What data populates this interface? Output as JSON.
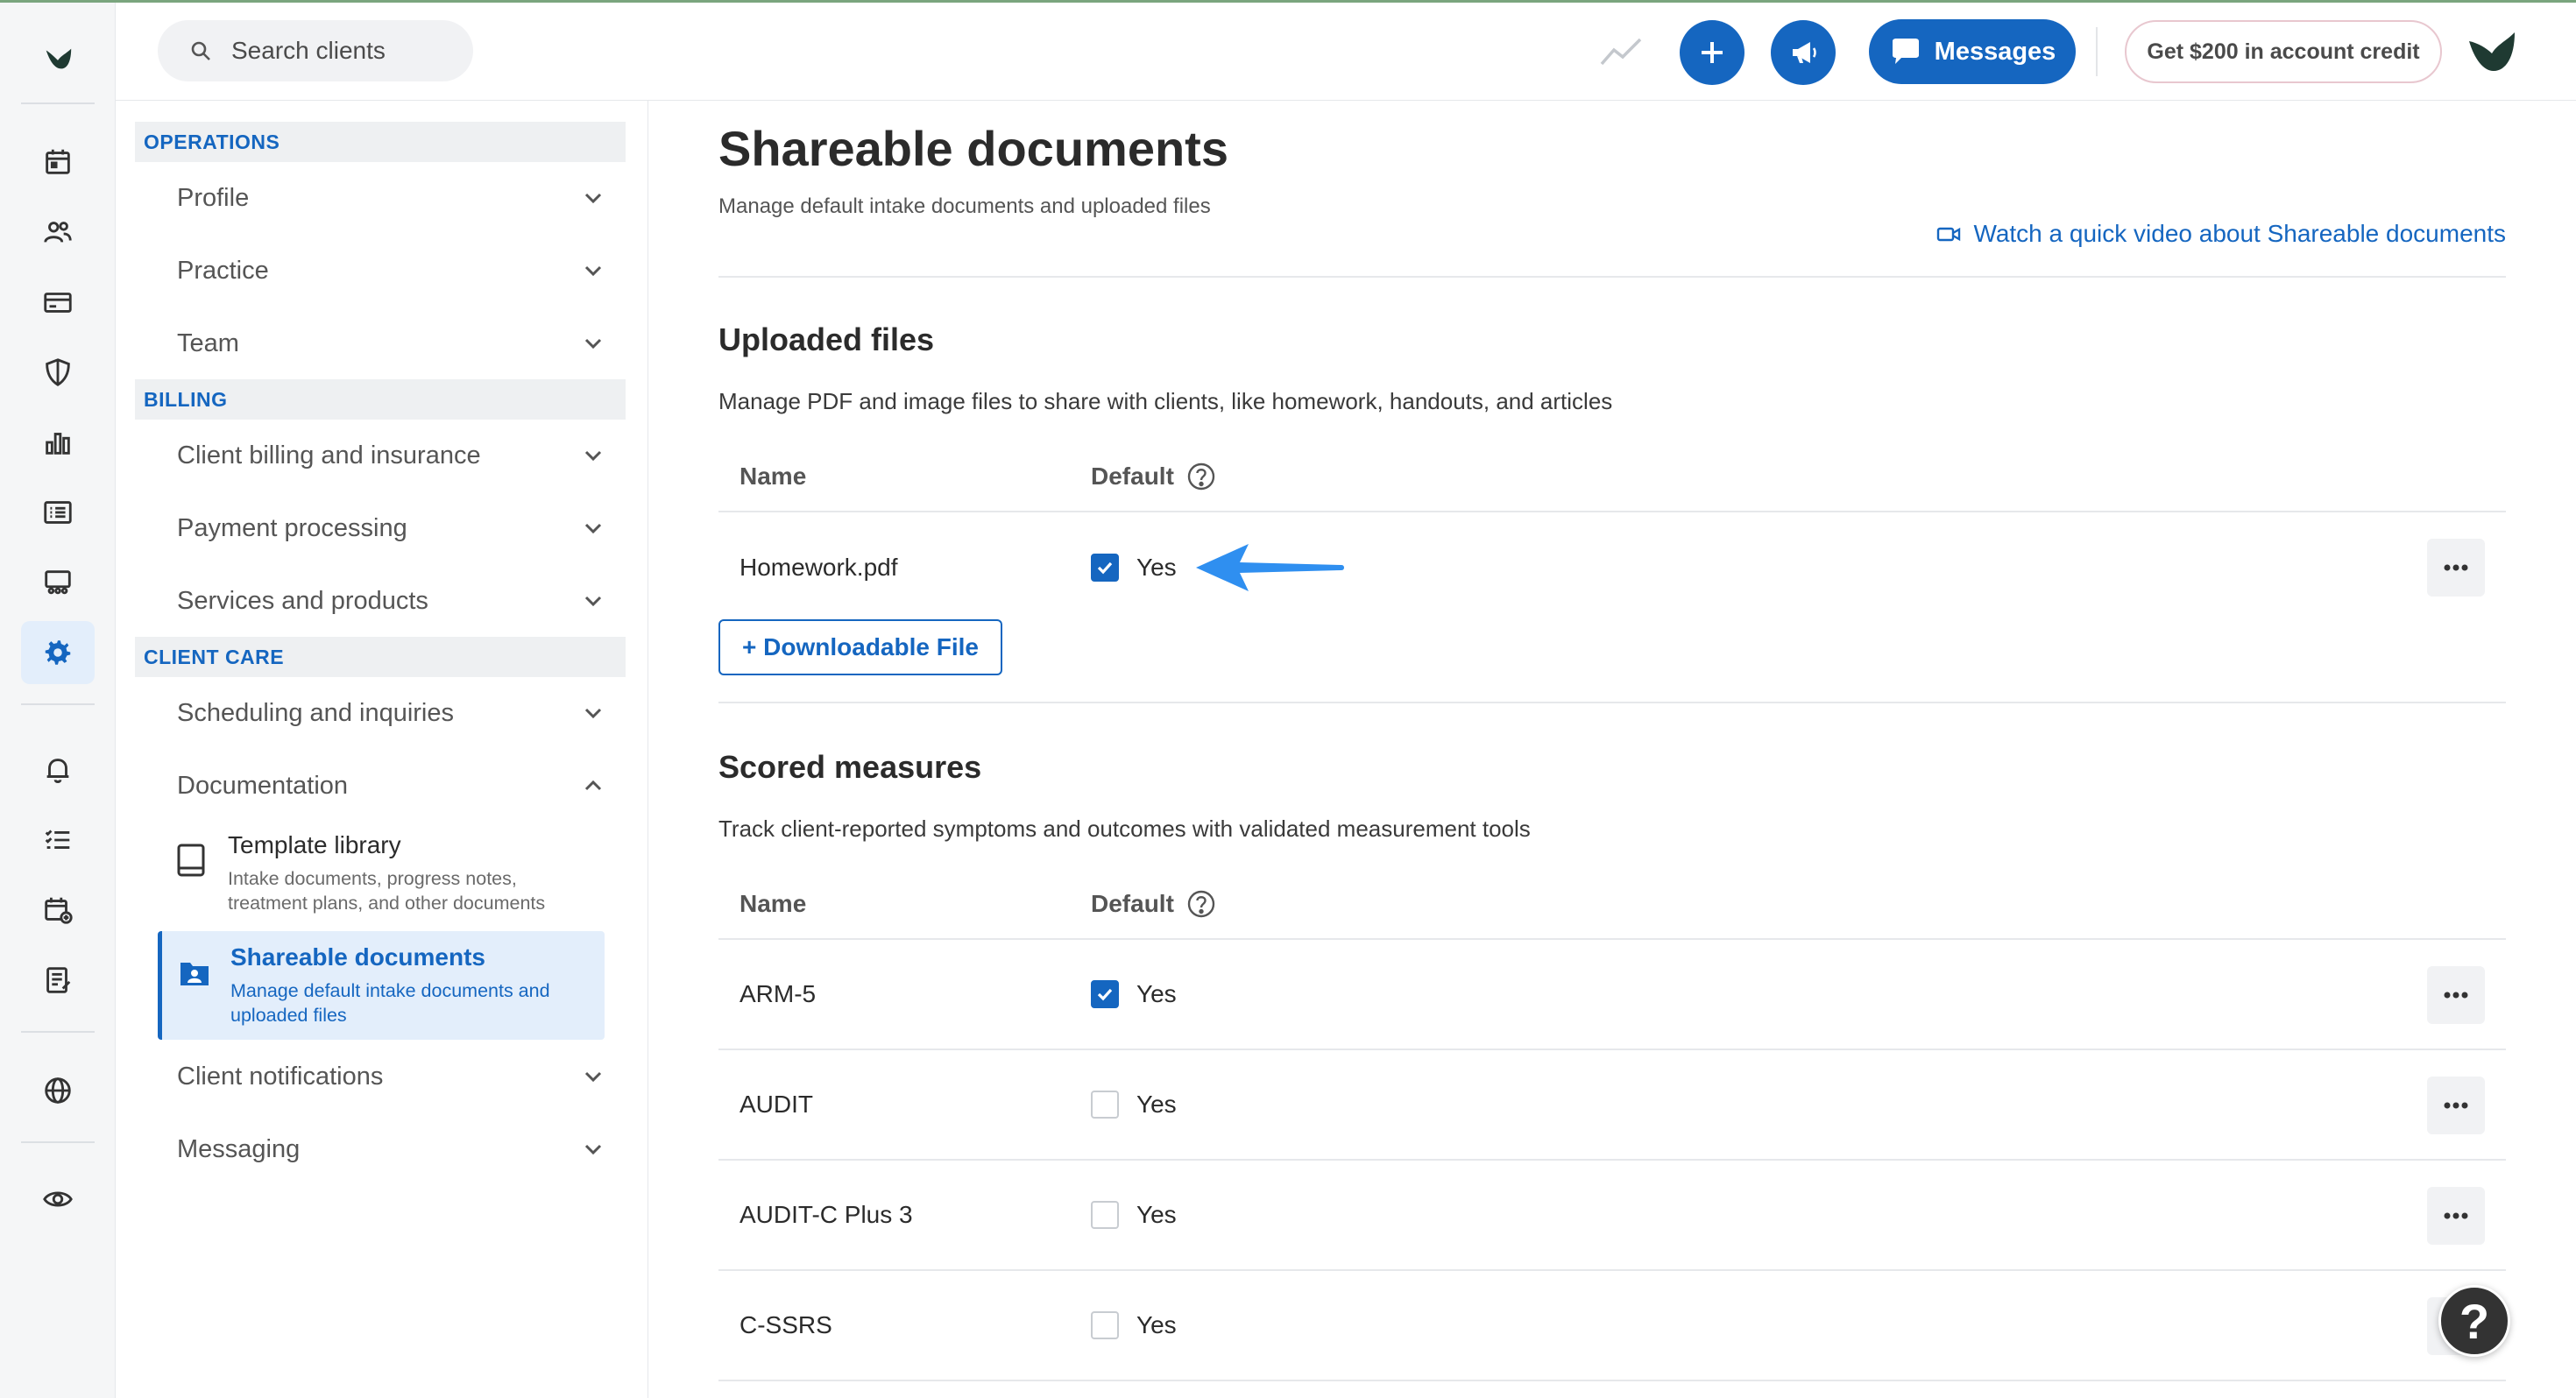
{
  "topbar": {
    "search_placeholder": "Search clients",
    "messages_label": "Messages",
    "credit_label": "Get $200 in account credit"
  },
  "nav": {
    "sections": {
      "operations": "OPERATIONS",
      "billing": "BILLING",
      "client_care": "CLIENT CARE"
    },
    "items": {
      "profile": "Profile",
      "practice": "Practice",
      "team": "Team",
      "client_billing": "Client billing and insurance",
      "payment_processing": "Payment processing",
      "services_products": "Services and products",
      "scheduling": "Scheduling and inquiries",
      "documentation": "Documentation",
      "client_notifications": "Client notifications",
      "messaging": "Messaging"
    },
    "documentation_sub": [
      {
        "title": "Template library",
        "description": "Intake documents, progress notes, treatment plans, and other documents"
      },
      {
        "title": "Shareable documents",
        "description": "Manage default intake documents and uploaded files"
      }
    ]
  },
  "main": {
    "title": "Shareable documents",
    "subtitle": "Manage default intake documents and uploaded files",
    "video_link": "Watch a quick video about Shareable documents",
    "uploaded": {
      "title": "Uploaded files",
      "description": "Manage PDF and image files to share with clients, like homework, handouts, and articles",
      "col_name": "Name",
      "col_default": "Default",
      "rows": [
        {
          "name": "Homework.pdf",
          "default_label": "Yes",
          "checked": true
        }
      ],
      "add_button": "+ Downloadable File"
    },
    "scored": {
      "title": "Scored measures",
      "description": "Track client-reported symptoms and outcomes with validated measurement tools",
      "col_name": "Name",
      "col_default": "Default",
      "rows": [
        {
          "name": "ARM-5",
          "default_label": "Yes",
          "checked": true
        },
        {
          "name": "AUDIT",
          "default_label": "Yes",
          "checked": false
        },
        {
          "name": "AUDIT-C Plus 3",
          "default_label": "Yes",
          "checked": false
        },
        {
          "name": "C-SSRS",
          "default_label": "Yes",
          "checked": false
        }
      ]
    }
  },
  "help_label": "?",
  "colors": {
    "primary": "#1566c0",
    "active_bg": "#e3eefb",
    "annotation_arrow": "#2f8ff0",
    "logo": "#1f3a32"
  }
}
